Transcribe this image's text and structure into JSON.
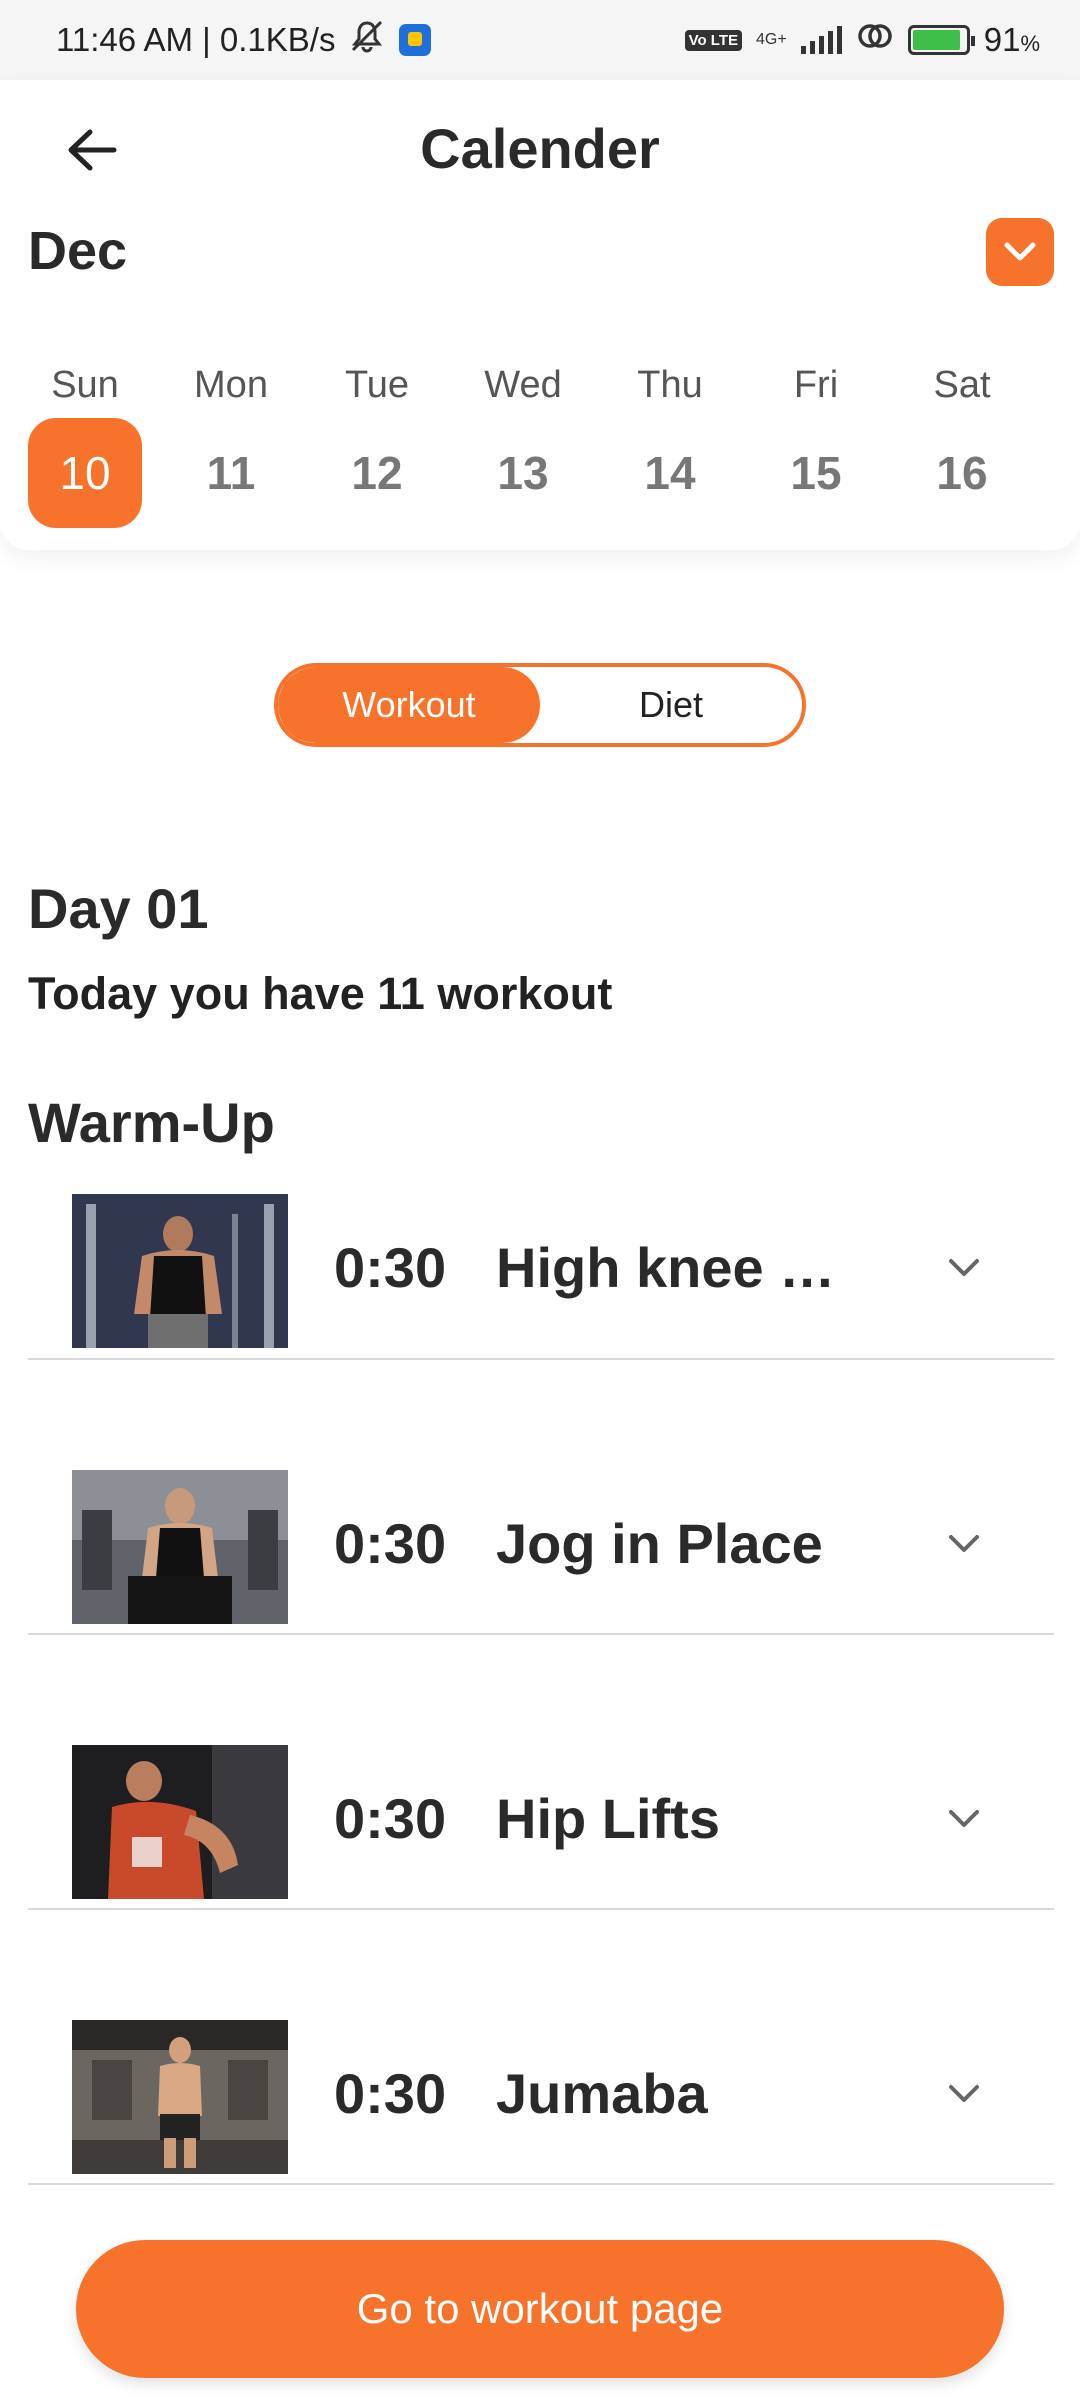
{
  "status_bar": {
    "time_speed": "11:46 AM | 0.1KB/s",
    "network_type": "4G+",
    "volte": "Vo LTE",
    "battery_percent": "91",
    "battery_percent_sign": "%",
    "icons": [
      "mute-icon",
      "app-notification-icon",
      "signal-icon",
      "hotspot-icon",
      "battery-charging-icon"
    ]
  },
  "header": {
    "back_icon": "arrow-left-icon",
    "title": "Calender"
  },
  "calendar": {
    "month": "Dec",
    "dropdown_icon": "chevron-down-icon",
    "days": [
      {
        "name": "Sun",
        "date": "10",
        "selected": true
      },
      {
        "name": "Mon",
        "date": "11",
        "selected": false
      },
      {
        "name": "Tue",
        "date": "12",
        "selected": false
      },
      {
        "name": "Wed",
        "date": "13",
        "selected": false
      },
      {
        "name": "Thu",
        "date": "14",
        "selected": false
      },
      {
        "name": "Fri",
        "date": "15",
        "selected": false
      },
      {
        "name": "Sat",
        "date": "16",
        "selected": false
      }
    ]
  },
  "toggle": {
    "options": [
      "Workout",
      "Diet"
    ],
    "active": "Workout"
  },
  "day": {
    "title": "Day 01",
    "summary": "Today you have 11 workout"
  },
  "section": {
    "title": "Warm-Up"
  },
  "workouts": [
    {
      "duration": "0:30",
      "name": "High knee …",
      "image": "man-in-gym-black-tank"
    },
    {
      "duration": "0:30",
      "name": "Jog in Place",
      "image": "man-seated-gym"
    },
    {
      "duration": "0:30",
      "name": "Hip Lifts",
      "image": "man-red-jersey"
    },
    {
      "duration": "0:30",
      "name": "Jumaba",
      "image": "shirtless-man-gym"
    }
  ],
  "cta": {
    "label": "Go to workout page"
  },
  "colors": {
    "accent": "#f7722a",
    "text": "#2a2a2a",
    "muted": "#777777",
    "divider": "#d9d9d9"
  }
}
